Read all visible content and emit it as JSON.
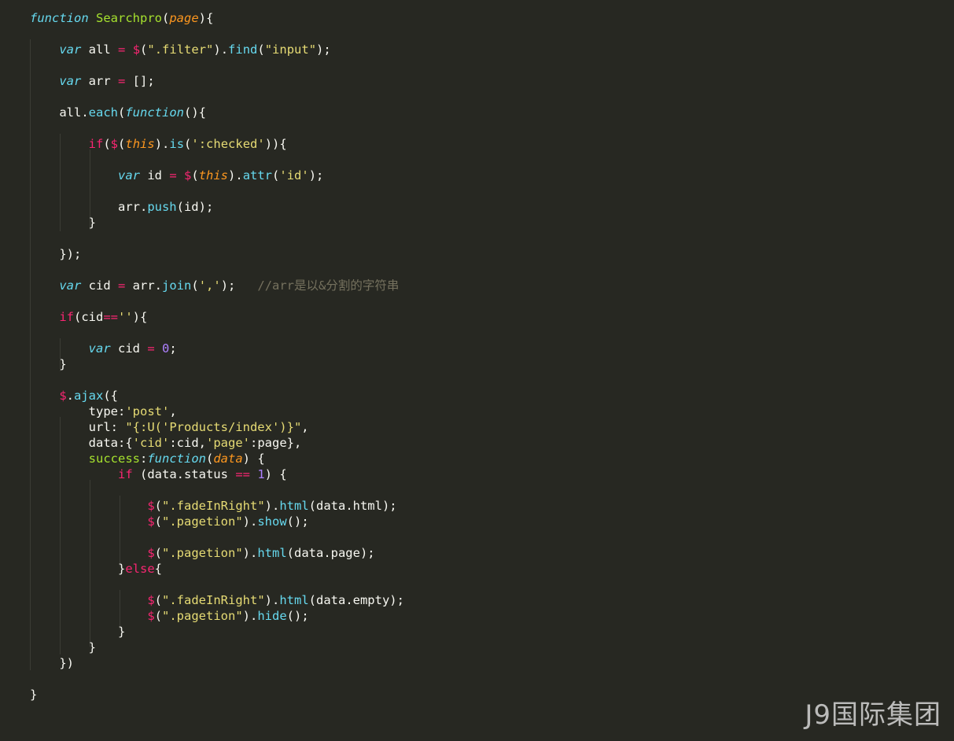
{
  "colors": {
    "background": "#272822",
    "keyword": "#F92672",
    "storage": "#66D9EF",
    "function_name": "#A6E22E",
    "string": "#E6DB74",
    "number": "#AE81FF",
    "parameter": "#FD971F",
    "comment": "#75715E",
    "text": "#F8F8F2"
  },
  "code": {
    "lines": [
      [
        [
          "st",
          "function"
        ],
        [
          "pl",
          " "
        ],
        [
          "fn",
          "Searchpro"
        ],
        [
          "pl",
          "("
        ],
        [
          "par",
          "page"
        ],
        [
          "pl",
          "){"
        ]
      ],
      [],
      [
        [
          "pl",
          "    "
        ],
        [
          "st",
          "var"
        ],
        [
          "pl",
          " all "
        ],
        [
          "kw",
          "="
        ],
        [
          "pl",
          " "
        ],
        [
          "kw",
          "$"
        ],
        [
          "pl",
          "("
        ],
        [
          "str",
          "\".filter\""
        ],
        [
          "pl",
          ")."
        ],
        [
          "call",
          "find"
        ],
        [
          "pl",
          "("
        ],
        [
          "str",
          "\"input\""
        ],
        [
          "pl",
          ");"
        ]
      ],
      [],
      [
        [
          "pl",
          "    "
        ],
        [
          "st",
          "var"
        ],
        [
          "pl",
          " arr "
        ],
        [
          "kw",
          "="
        ],
        [
          "pl",
          " [];"
        ]
      ],
      [],
      [
        [
          "pl",
          "    all."
        ],
        [
          "call",
          "each"
        ],
        [
          "pl",
          "("
        ],
        [
          "st",
          "function"
        ],
        [
          "pl",
          "(){"
        ]
      ],
      [],
      [
        [
          "pl",
          "        "
        ],
        [
          "kw",
          "if"
        ],
        [
          "pl",
          "("
        ],
        [
          "kw",
          "$"
        ],
        [
          "pl",
          "("
        ],
        [
          "par",
          "this"
        ],
        [
          "pl",
          ")."
        ],
        [
          "call",
          "is"
        ],
        [
          "pl",
          "("
        ],
        [
          "str",
          "':checked'"
        ],
        [
          "pl",
          "))"
        ],
        [
          "pl",
          "{"
        ]
      ],
      [],
      [
        [
          "pl",
          "            "
        ],
        [
          "st",
          "var"
        ],
        [
          "pl",
          " id "
        ],
        [
          "kw",
          "="
        ],
        [
          "pl",
          " "
        ],
        [
          "kw",
          "$"
        ],
        [
          "pl",
          "("
        ],
        [
          "par",
          "this"
        ],
        [
          "pl",
          ")."
        ],
        [
          "call",
          "attr"
        ],
        [
          "pl",
          "("
        ],
        [
          "str",
          "'id'"
        ],
        [
          "pl",
          ");"
        ]
      ],
      [],
      [
        [
          "pl",
          "            arr."
        ],
        [
          "call",
          "push"
        ],
        [
          "pl",
          "(id);"
        ]
      ],
      [
        [
          "pl",
          "        }"
        ]
      ],
      [],
      [
        [
          "pl",
          "    });"
        ]
      ],
      [],
      [
        [
          "pl",
          "    "
        ],
        [
          "st",
          "var"
        ],
        [
          "pl",
          " cid "
        ],
        [
          "kw",
          "="
        ],
        [
          "pl",
          " arr."
        ],
        [
          "call",
          "join"
        ],
        [
          "pl",
          "("
        ],
        [
          "str",
          "','"
        ],
        [
          "pl",
          ");   "
        ],
        [
          "cm",
          "//arr是以&分割的字符串"
        ]
      ],
      [],
      [
        [
          "pl",
          "    "
        ],
        [
          "kw",
          "if"
        ],
        [
          "pl",
          "(cid"
        ],
        [
          "kw",
          "=="
        ],
        [
          "str",
          "''"
        ],
        [
          "pl",
          "){"
        ]
      ],
      [],
      [
        [
          "pl",
          "        "
        ],
        [
          "st",
          "var"
        ],
        [
          "pl",
          " cid "
        ],
        [
          "kw",
          "="
        ],
        [
          "pl",
          " "
        ],
        [
          "num",
          "0"
        ],
        [
          "pl",
          ";"
        ]
      ],
      [
        [
          "pl",
          "    }"
        ]
      ],
      [],
      [
        [
          "pl",
          "    "
        ],
        [
          "kw",
          "$"
        ],
        [
          "pl",
          "."
        ],
        [
          "call",
          "ajax"
        ],
        [
          "pl",
          "({"
        ]
      ],
      [
        [
          "pl",
          "        type:"
        ],
        [
          "str",
          "'post'"
        ],
        [
          "pl",
          ","
        ]
      ],
      [
        [
          "pl",
          "        url: "
        ],
        [
          "str",
          "\"{:U('Products/index')}\""
        ],
        [
          "pl",
          ","
        ]
      ],
      [
        [
          "pl",
          "        data:{"
        ],
        [
          "str",
          "'cid'"
        ],
        [
          "pl",
          ":cid,"
        ],
        [
          "str",
          "'page'"
        ],
        [
          "pl",
          ":page},"
        ]
      ],
      [
        [
          "pl",
          "        "
        ],
        [
          "fn",
          "success"
        ],
        [
          "pl",
          ":"
        ],
        [
          "st",
          "function"
        ],
        [
          "pl",
          "("
        ],
        [
          "par",
          "data"
        ],
        [
          "pl",
          ") {"
        ]
      ],
      [
        [
          "pl",
          "            "
        ],
        [
          "kw",
          "if"
        ],
        [
          "pl",
          " (data.status "
        ],
        [
          "kw",
          "=="
        ],
        [
          "pl",
          " "
        ],
        [
          "num",
          "1"
        ],
        [
          "pl",
          ") {"
        ]
      ],
      [],
      [
        [
          "pl",
          "                "
        ],
        [
          "kw",
          "$"
        ],
        [
          "pl",
          "("
        ],
        [
          "str",
          "\".fadeInRight\""
        ],
        [
          "pl",
          ")."
        ],
        [
          "call",
          "html"
        ],
        [
          "pl",
          "(data.html);"
        ]
      ],
      [
        [
          "pl",
          "                "
        ],
        [
          "kw",
          "$"
        ],
        [
          "pl",
          "("
        ],
        [
          "str",
          "\".pagetion\""
        ],
        [
          "pl",
          ")."
        ],
        [
          "call",
          "show"
        ],
        [
          "pl",
          "();"
        ]
      ],
      [],
      [
        [
          "pl",
          "                "
        ],
        [
          "kw",
          "$"
        ],
        [
          "pl",
          "("
        ],
        [
          "str",
          "\".pagetion\""
        ],
        [
          "pl",
          ")."
        ],
        [
          "call",
          "html"
        ],
        [
          "pl",
          "(data.page);"
        ]
      ],
      [
        [
          "pl",
          "            }"
        ],
        [
          "kw",
          "else"
        ],
        [
          "pl",
          "{"
        ]
      ],
      [],
      [
        [
          "pl",
          "                "
        ],
        [
          "kw",
          "$"
        ],
        [
          "pl",
          "("
        ],
        [
          "str",
          "\".fadeInRight\""
        ],
        [
          "pl",
          ")."
        ],
        [
          "call",
          "html"
        ],
        [
          "pl",
          "(data.empty);"
        ]
      ],
      [
        [
          "pl",
          "                "
        ],
        [
          "kw",
          "$"
        ],
        [
          "pl",
          "("
        ],
        [
          "str",
          "\".pagetion\""
        ],
        [
          "pl",
          ")."
        ],
        [
          "call",
          "hide"
        ],
        [
          "pl",
          "();"
        ]
      ],
      [
        [
          "pl",
          "            }"
        ]
      ],
      [
        [
          "pl",
          "        }"
        ]
      ],
      [
        [
          "pl",
          "    })"
        ]
      ],
      [],
      [
        [
          "pl",
          "}"
        ]
      ]
    ]
  },
  "watermark": {
    "text": "J9国际集团"
  }
}
